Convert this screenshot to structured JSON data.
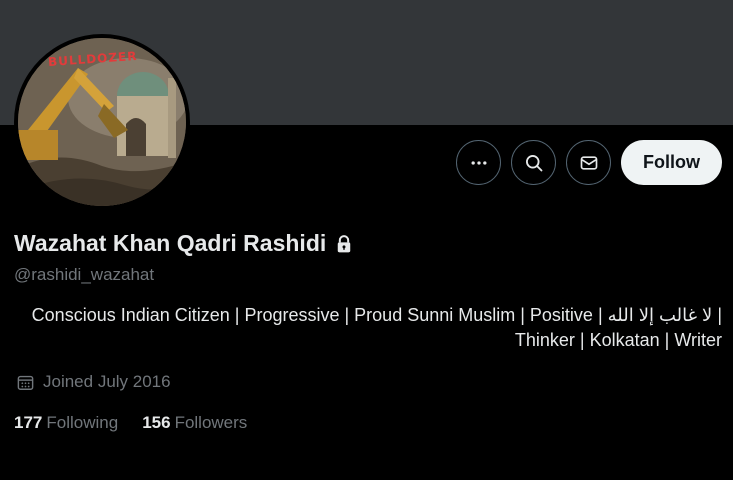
{
  "profile": {
    "display_name": "Wazahat Khan Qadri Rashidi",
    "handle": "@rashidi_wazahat",
    "bio": "Conscious Indian Citizen | Progressive | Proud Sunni Muslim | Positive | لا غالب إلا الله | Thinker | Kolkatan | Writer",
    "avatar_text": "BULLDOZER",
    "joined": "Joined July 2016",
    "following_count": "177",
    "following_label": "Following",
    "followers_count": "156",
    "followers_label": "Followers",
    "protected": true
  },
  "actions": {
    "more_icon": "more-horizontal-icon",
    "search_icon": "search-icon",
    "message_icon": "mail-icon",
    "follow_label": "Follow"
  },
  "colors": {
    "background": "#000000",
    "banner": "#333639",
    "text_primary": "#e7e9ea",
    "text_secondary": "#71767b",
    "follow_bg": "#eff3f4",
    "border": "#536471"
  }
}
